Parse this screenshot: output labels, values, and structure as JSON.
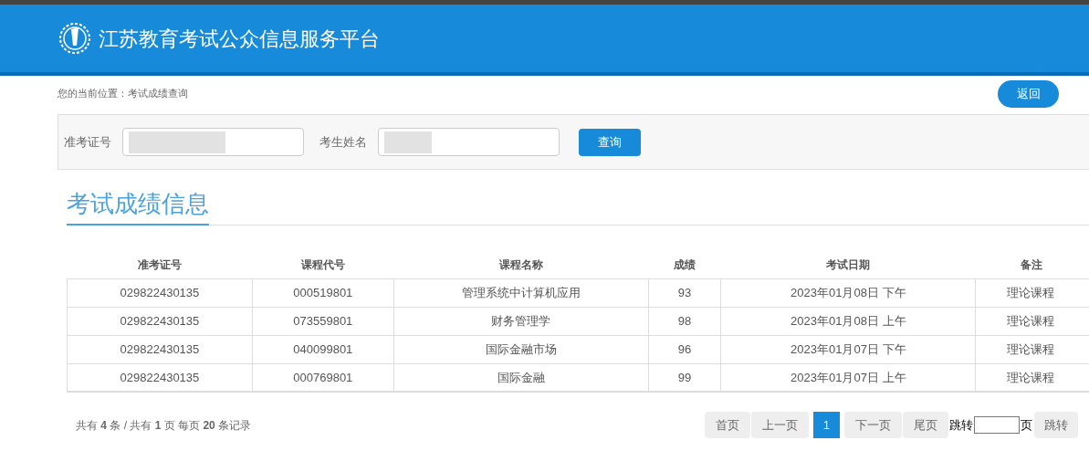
{
  "header": {
    "title": "江苏教育考试公众信息服务平台"
  },
  "breadcrumb": "您的当前位置：考试成绩查询",
  "back_button": "返回",
  "search": {
    "fields": [
      {
        "label": "准考证号",
        "redacted": true
      },
      {
        "label": "考生姓名",
        "redacted": true
      }
    ],
    "button": "查询"
  },
  "section_title": "考试成绩信息",
  "table": {
    "columns": [
      "准考证号",
      "课程代号",
      "课程名称",
      "成绩",
      "考试日期",
      "备注"
    ],
    "rows": [
      [
        "029822430135",
        "000519801",
        "管理系统中计算机应用",
        "93",
        "2023年01月08日 下午",
        "理论课程"
      ],
      [
        "029822430135",
        "073559801",
        "财务管理学",
        "98",
        "2023年01月08日 上午",
        "理论课程"
      ],
      [
        "029822430135",
        "040099801",
        "国际金融市场",
        "96",
        "2023年01月07日 下午",
        "理论课程"
      ],
      [
        "029822430135",
        "000769801",
        "国际金融",
        "99",
        "2023年01月07日 上午",
        "理论课程"
      ]
    ]
  },
  "pagination": {
    "summary": "共有 **4** 条 / 共有 **1** 页 每页 **20** 条记录",
    "pages": [
      {
        "label": "首页",
        "selected": false
      },
      {
        "label": "上一页",
        "selected": false
      },
      {
        "label": "1",
        "selected": true
      },
      {
        "label": "下一页",
        "selected": false
      },
      {
        "label": "尾页",
        "selected": false
      }
    ],
    "jump_label": "跳转",
    "page_unit": "页",
    "jump_button": "跳转"
  }
}
